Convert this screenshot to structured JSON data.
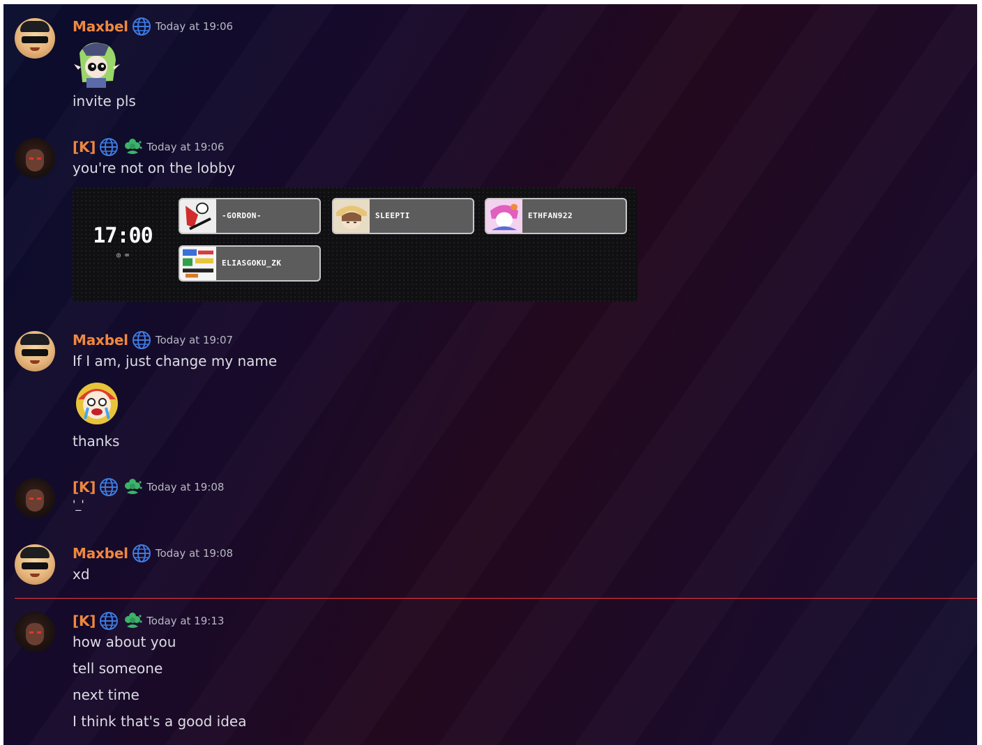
{
  "messages": [
    {
      "author": "Maxbel",
      "time": "Today at 19:06",
      "lines": [
        "invite pls"
      ],
      "sticker": "elf-with-glasses-sticker"
    },
    {
      "author": "[K]",
      "time": "Today at 19:06",
      "lines": [
        "you're not on the lobby"
      ]
    },
    {
      "author": "Maxbel",
      "time": "Today at 19:07",
      "lines": [
        "If I am, just change my name",
        "thanks"
      ],
      "sticker": "crying-clown-sticker"
    },
    {
      "author": "[K]",
      "time": "Today at 19:08",
      "lines": [
        "'_'"
      ]
    },
    {
      "author": "Maxbel",
      "time": "Today at 19:08",
      "lines": [
        "xd"
      ]
    },
    {
      "author": "[K]",
      "time": "Today at 19:13",
      "lines": [
        "how about you",
        "tell someone",
        "next time",
        "I think that's a good idea"
      ]
    }
  ],
  "lobby": {
    "clock": "17:00",
    "clock_sub": "◎ ∞",
    "players": [
      "-GORDON-",
      "SLEEPTI",
      "ETHFAN922",
      "ELIASGOKU_ZK"
    ]
  },
  "colors": {
    "author_name": "#f0883e",
    "divider": "#f2343f",
    "timestamp": "#b8b9c4",
    "text": "#dcdde3"
  }
}
